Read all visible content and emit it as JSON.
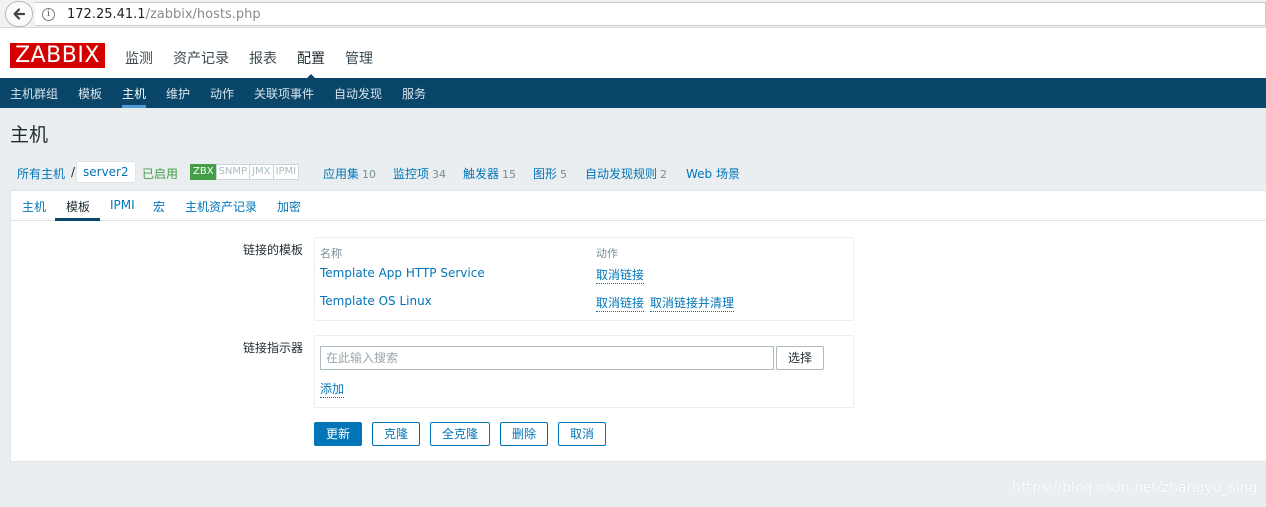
{
  "browser": {
    "url_host": "172.25.41.1",
    "url_path": "/zabbix/hosts.php"
  },
  "header": {
    "logo": "ZABBIX",
    "menu": [
      {
        "label": "监测"
      },
      {
        "label": "资产记录"
      },
      {
        "label": "报表"
      },
      {
        "label": "配置",
        "active": true
      },
      {
        "label": "管理"
      }
    ]
  },
  "subnav": {
    "items": [
      {
        "label": "主机群组"
      },
      {
        "label": "模板"
      },
      {
        "label": "主机",
        "active": true
      },
      {
        "label": "维护"
      },
      {
        "label": "动作"
      },
      {
        "label": "关联项事件"
      },
      {
        "label": "自动发现"
      },
      {
        "label": "服务"
      }
    ]
  },
  "page": {
    "title": "主机"
  },
  "breadcrumb": {
    "all_hosts": "所有主机",
    "separator": "/",
    "current": "server2",
    "status": "已启用",
    "availability": [
      {
        "label": "ZBX",
        "on": true
      },
      {
        "label": "SNMP",
        "on": false
      },
      {
        "label": "JMX",
        "on": false
      },
      {
        "label": "IPMI",
        "on": false
      }
    ],
    "links": [
      {
        "label": "应用集",
        "count": "10"
      },
      {
        "label": "监控项",
        "count": "34"
      },
      {
        "label": "触发器",
        "count": "15"
      },
      {
        "label": "图形",
        "count": "5"
      },
      {
        "label": "自动发现规则",
        "count": "2"
      },
      {
        "label": "Web 场景",
        "count": ""
      }
    ]
  },
  "tabs": [
    {
      "label": "主机"
    },
    {
      "label": "模板",
      "active": true
    },
    {
      "label": "IPMI"
    },
    {
      "label": "宏"
    },
    {
      "label": "主机资产记录"
    },
    {
      "label": "加密"
    }
  ],
  "linked_templates": {
    "label": "链接的模板",
    "col_name": "名称",
    "col_action": "动作",
    "rows": [
      {
        "name": "Template App HTTP Service",
        "actions": [
          "取消链接"
        ]
      },
      {
        "name": "Template OS Linux",
        "actions": [
          "取消链接",
          "取消链接并清理"
        ]
      }
    ]
  },
  "link_indicator": {
    "label": "链接指示器",
    "placeholder": "在此输入搜索",
    "value": "",
    "select_label": "选择",
    "add_label": "添加"
  },
  "buttons": {
    "update": "更新",
    "clone": "克隆",
    "full_clone": "全克隆",
    "delete": "删除",
    "cancel": "取消"
  },
  "watermark": "https://blog.csdn.net/zhangyu_sing",
  "colors": {
    "accent": "#0275b8",
    "nav_bg": "#0a466a",
    "logo_red": "#d40000",
    "enabled_green": "#429e47"
  }
}
